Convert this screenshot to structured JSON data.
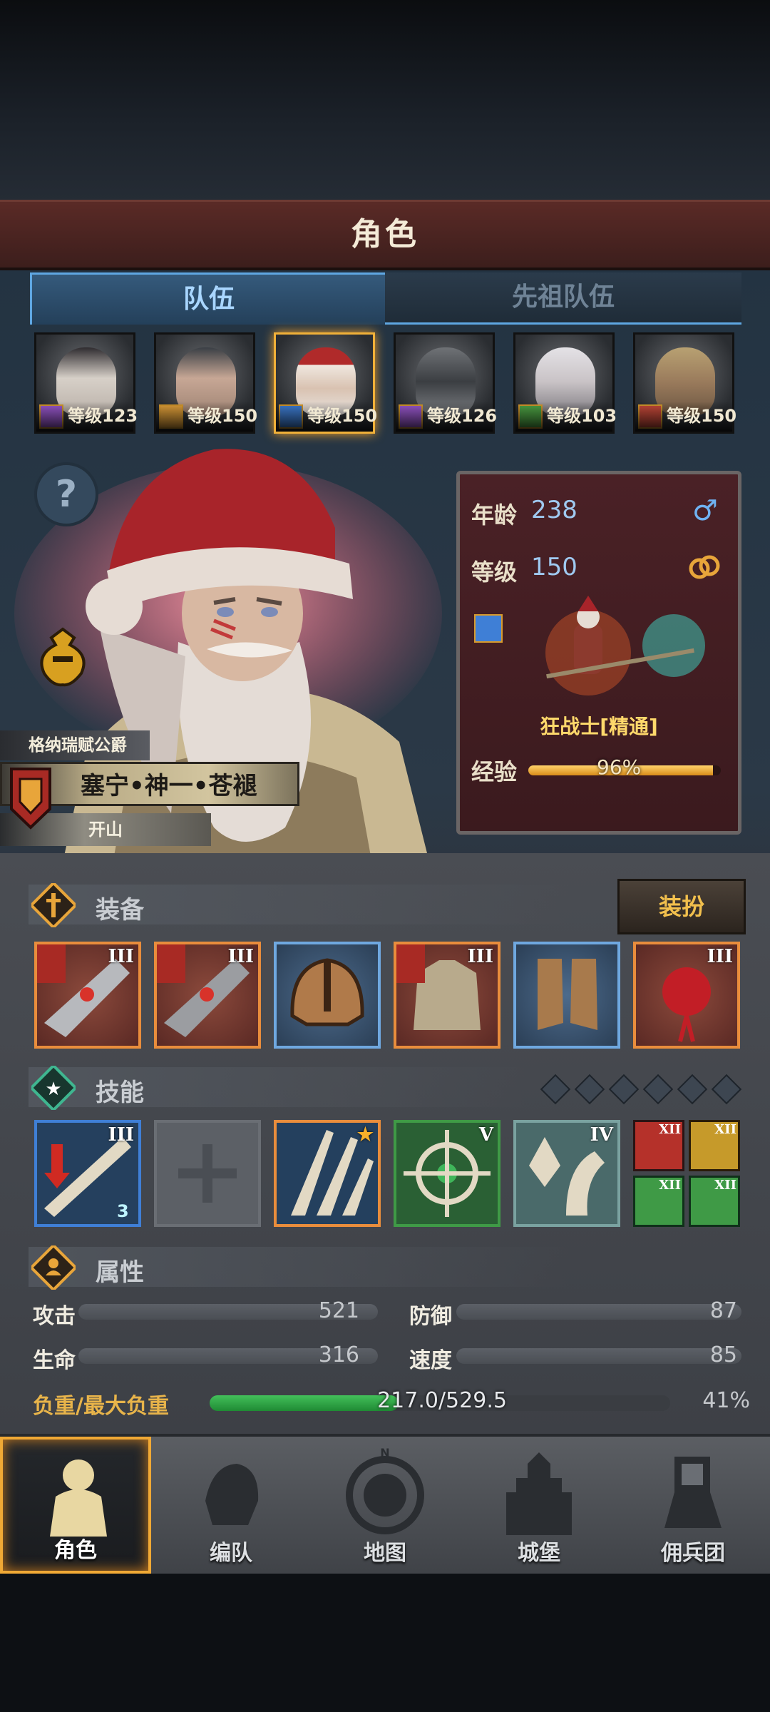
{
  "header": {
    "title": "角色"
  },
  "tabs": [
    {
      "label": "队伍",
      "active": true
    },
    {
      "label": "先祖队伍",
      "active": false
    }
  ],
  "heroes": [
    {
      "level_label": "等级123",
      "class_color": "#9b59d0",
      "selected": false
    },
    {
      "level_label": "等级150",
      "class_color": "#e3a13a",
      "selected": false
    },
    {
      "level_label": "等级150",
      "class_color": "#3f7fd6",
      "selected": true
    },
    {
      "level_label": "等级126",
      "class_color": "#9b59d0",
      "selected": false
    },
    {
      "level_label": "等级103",
      "class_color": "#4fa545",
      "selected": false
    },
    {
      "level_label": "等级150",
      "class_color": "#c84a3a",
      "selected": false
    }
  ],
  "character": {
    "title_tag": "格纳瑞赋公爵",
    "name": "塞宁•神一•苍褪",
    "subtitle": "开山",
    "age_label": "年龄",
    "age": "238",
    "level_label": "等级",
    "level": "150",
    "job": "狂战士[精通]",
    "exp_label": "经验",
    "exp_percent": "96%",
    "exp_value": 0.96
  },
  "equipment": {
    "label": "装备",
    "dress_button": "装扮",
    "slots": [
      {
        "name": "weapon",
        "rank": "III",
        "rarity": "orange",
        "badge": true
      },
      {
        "name": "weapon-offhand",
        "rank": "III",
        "rarity": "orange",
        "badge": true
      },
      {
        "name": "helmet",
        "rank": "",
        "rarity": "blue",
        "badge": false
      },
      {
        "name": "armor",
        "rank": "III",
        "rarity": "orange",
        "badge": true
      },
      {
        "name": "boots",
        "rank": "",
        "rarity": "blue",
        "badge": false
      },
      {
        "name": "accessory",
        "rank": "III",
        "rarity": "orange",
        "badge": false
      }
    ]
  },
  "skills": {
    "label": "技能",
    "slots": [
      {
        "name": "sword-debuff",
        "rank": "III",
        "badge": "3",
        "frame": "#3f7fd6"
      },
      {
        "name": "empty-skill",
        "rank": "",
        "badge": "",
        "frame": "#6a6e74"
      },
      {
        "name": "claw-strike",
        "rank": "★",
        "badge": "",
        "frame": "#e98d3c"
      },
      {
        "name": "target-lock",
        "rank": "V",
        "badge": "",
        "frame": "#3f9a46"
      },
      {
        "name": "crystal-arm",
        "rank": "IV",
        "badge": "",
        "frame": "#7aa2a0"
      }
    ],
    "passive": [
      {
        "rank": "XII",
        "color": "#b5312a"
      },
      {
        "rank": "XII",
        "color": "#c69a2a"
      },
      {
        "rank": "XII",
        "color": "#3f9a46"
      },
      {
        "rank": "XII",
        "color": "#3f9a46"
      }
    ]
  },
  "attributes": {
    "label": "属性",
    "attack_label": "攻击",
    "attack": "521",
    "defense_label": "防御",
    "defense": "87",
    "hp_label": "生命",
    "hp": "316",
    "speed_label": "速度",
    "speed": "85",
    "load_label": "负重/最大负重",
    "load": "217.0/529.5",
    "load_percent": "41%",
    "load_value": 0.41
  },
  "nav": [
    {
      "label": "角色",
      "active": true
    },
    {
      "label": "编队",
      "active": false
    },
    {
      "label": "地图",
      "active": false
    },
    {
      "label": "城堡",
      "active": false
    },
    {
      "label": "佣兵团",
      "active": false
    }
  ]
}
